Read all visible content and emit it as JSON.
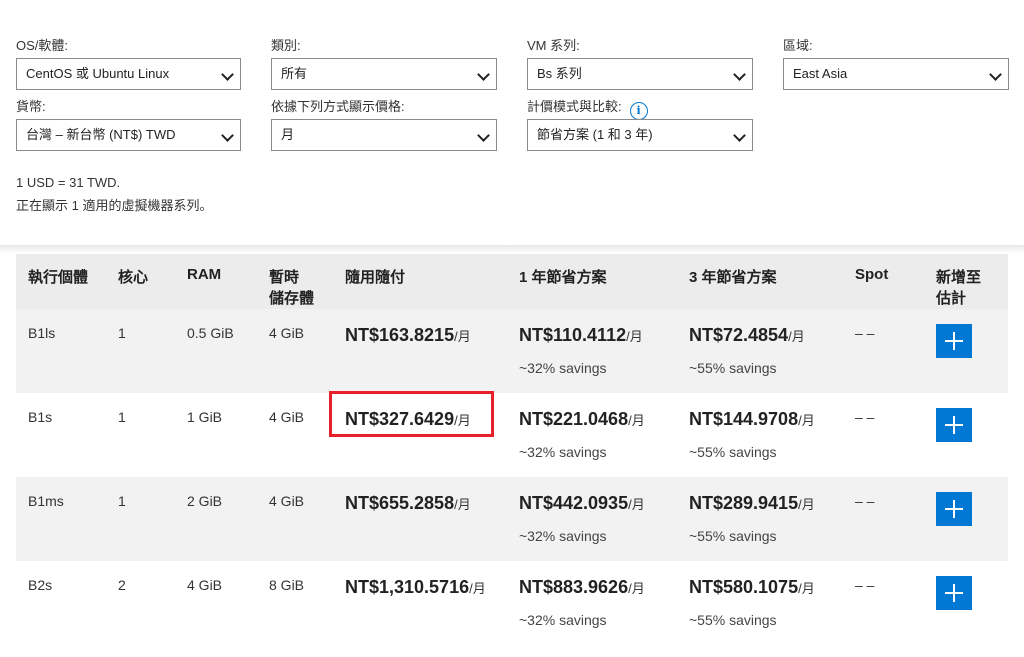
{
  "filters": {
    "os": {
      "label": "OS/軟體:",
      "value": "CentOS 或 Ubuntu Linux"
    },
    "category": {
      "label": "類別:",
      "value": "所有"
    },
    "vm_series": {
      "label": "VM 系列:",
      "value": "Bs 系列"
    },
    "region": {
      "label": "區域:",
      "value": "East Asia"
    },
    "currency": {
      "label": "貨幣:",
      "value": "台灣 – 新台幣 (NT$) TWD"
    },
    "display_price": {
      "label": "依據下列方式顯示價格:",
      "value": "月"
    },
    "pricing_model": {
      "label": "計價模式與比較:",
      "value": "節省方案 (1 和 3 年)",
      "info_icon": "info-icon"
    }
  },
  "notes": {
    "exchange": "1 USD = 31 TWD.",
    "showing": "正在顯示 1 適用的虛擬機器系列。"
  },
  "table": {
    "headers": {
      "instance": "執行個體",
      "cores": "核心",
      "ram": "RAM",
      "temp_storage_1": "暫時",
      "temp_storage_2": "儲存體",
      "payg": "隨用隨付",
      "one_year": "1 年節省方案",
      "three_year": "3 年節省方案",
      "spot": "Spot",
      "add_1": "新增至",
      "add_2": "估計"
    },
    "unit": "/月",
    "rows": [
      {
        "instance": "B1ls",
        "cores": "1",
        "ram": "0.5 GiB",
        "storage": "4 GiB",
        "payg": "NT$163.8215",
        "one_year": "NT$110.4112",
        "one_year_savings": "~32% savings",
        "three_year": "NT$72.4854",
        "three_year_savings": "~55% savings",
        "spot": "– –"
      },
      {
        "instance": "B1s",
        "cores": "1",
        "ram": "1 GiB",
        "storage": "4 GiB",
        "payg": "NT$327.6429",
        "one_year": "NT$221.0468",
        "one_year_savings": "~32% savings",
        "three_year": "NT$144.9708",
        "three_year_savings": "~55% savings",
        "spot": "– –"
      },
      {
        "instance": "B1ms",
        "cores": "1",
        "ram": "2 GiB",
        "storage": "4 GiB",
        "payg": "NT$655.2858",
        "one_year": "NT$442.0935",
        "one_year_savings": "~32% savings",
        "three_year": "NT$289.9415",
        "three_year_savings": "~55% savings",
        "spot": "– –"
      },
      {
        "instance": "B2s",
        "cores": "2",
        "ram": "4 GiB",
        "storage": "8 GiB",
        "payg": "NT$1,310.5716",
        "one_year": "NT$883.9626",
        "one_year_savings": "~32% savings",
        "three_year": "NT$580.1075",
        "three_year_savings": "~55% savings",
        "spot": "– –"
      }
    ]
  },
  "colors": {
    "accent": "#0078d4",
    "highlight": "#e8202a"
  }
}
